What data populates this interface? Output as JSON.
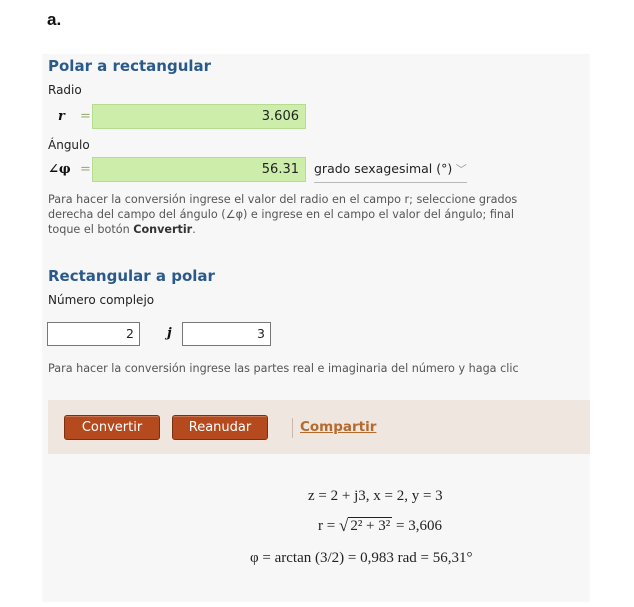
{
  "figure_label": "a.",
  "polar": {
    "title": "Polar a rectangular",
    "radius_label": "Radio",
    "r_symbol": "r",
    "equals": "=",
    "r_value": "3.606",
    "angle_label": "Ángulo",
    "phi_symbol": "∠φ",
    "phi_value": "56.31",
    "unit_value": "grado sexagesimal (°)",
    "help_line1": "Para hacer la conversión ingrese el valor del radio en el campo r; seleccione grados",
    "help_line2": "derecha del campo del ángulo (∠φ) e ingrese en el campo el valor del ángulo; final",
    "help_line3_prefix": "toque el botón ",
    "help_line3_bold": "Convertir",
    "help_line3_suffix": "."
  },
  "rect": {
    "title": "Rectangular a polar",
    "complex_label": "Número complejo",
    "real_value": "2",
    "j_symbol": "j",
    "imag_value": "3",
    "help": "Para hacer la conversión ingrese las partes real e imaginaria del número y haga clic"
  },
  "buttons": {
    "convert": "Convertir",
    "reset": "Reanudar",
    "share": "Compartir"
  },
  "result": {
    "line1": "z = 2 + j3, x = 2, y = 3",
    "line2_left": "r = ",
    "line2_radicand": "2² + 3²",
    "line2_right": " = 3,606",
    "line3": "φ = arctan (3/2) = 0,983 rad = 56,31°"
  }
}
